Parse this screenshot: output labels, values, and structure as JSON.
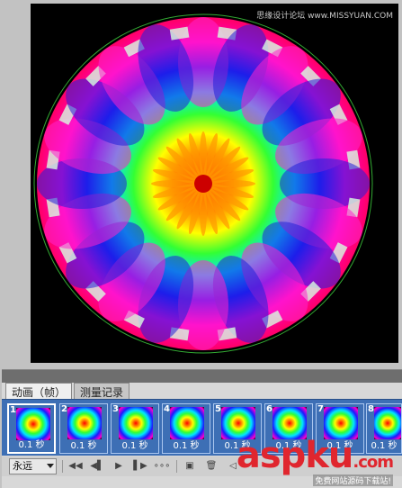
{
  "watermark_top": "思缘设计论坛 www.MISSYUAN.COM",
  "tabs": [
    {
      "label": "动画（帧）",
      "active": true
    },
    {
      "label": "测量记录",
      "active": false
    }
  ],
  "frames": [
    {
      "number": "1",
      "delay": "0.1 秒",
      "selected": true
    },
    {
      "number": "2",
      "delay": "0.1 秒",
      "selected": false
    },
    {
      "number": "3",
      "delay": "0.1 秒",
      "selected": false
    },
    {
      "number": "4",
      "delay": "0.1 秒",
      "selected": false
    },
    {
      "number": "5",
      "delay": "0.1 秒",
      "selected": false
    },
    {
      "number": "6",
      "delay": "0.1 秒",
      "selected": false
    },
    {
      "number": "7",
      "delay": "0.1 秒",
      "selected": false
    },
    {
      "number": "8",
      "delay": "0.1 秒",
      "selected": false
    }
  ],
  "controls": {
    "loop_value": "永远",
    "buttons": [
      "first-frame-icon",
      "prev-frame-icon",
      "play-icon",
      "next-frame-icon",
      "tween-icon",
      "duplicate-frame-icon",
      "delete-frame-icon",
      "convert-icon"
    ]
  },
  "logo": {
    "main": "aspku",
    "tld": ".com",
    "sub": "免费网站源码下载站!"
  },
  "colors": {
    "panel_blue": "#3d6fb5",
    "logo_red": "#e0262e"
  }
}
